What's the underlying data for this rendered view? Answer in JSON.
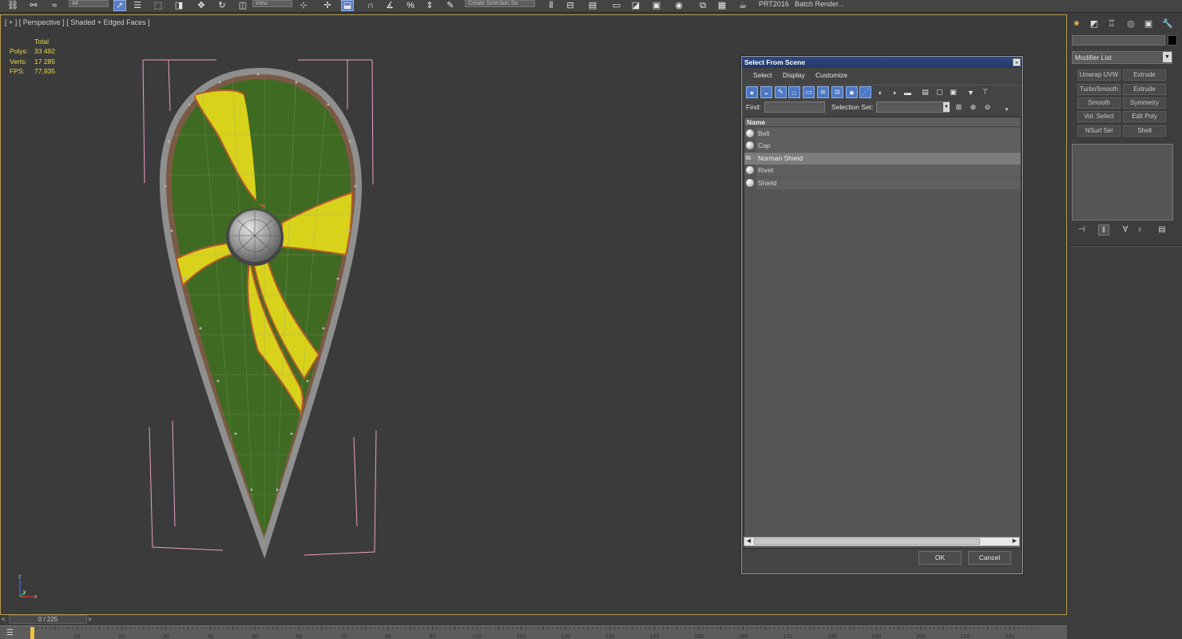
{
  "toolbar": {
    "filter_dropdown": "All",
    "coord_dropdown": "View",
    "selection_set_dropdown": "Create Selection Se",
    "prt_label": "PRT2016",
    "batch_render_label": "Batch Render..."
  },
  "viewport": {
    "label": "[ + ] [ Perspective ] [ Shaded + Edged Faces ]",
    "stats": {
      "total_label": "Total",
      "polys_label": "Polys:",
      "polys_value": "33 492",
      "verts_label": "Verts:",
      "verts_value": "17 285",
      "fps_label": "FPS:",
      "fps_value": "77,935"
    },
    "axis": {
      "z": "z",
      "y": "y",
      "x": "x"
    }
  },
  "dialog": {
    "title": "Select From Scene",
    "close": "×",
    "menu": [
      "Select",
      "Display",
      "Customize"
    ],
    "find_label": "Find:",
    "find_value": "",
    "selection_set_label": "Selection Set:",
    "column_header": "Name",
    "items": [
      {
        "name": "Belt",
        "icon": "sphere-icon",
        "selected": false
      },
      {
        "name": "Cap",
        "icon": "sphere-icon",
        "selected": false
      },
      {
        "name": "Norman Shield",
        "icon": "group-icon",
        "selected": true
      },
      {
        "name": "Rivet",
        "icon": "sphere-icon",
        "selected": false
      },
      {
        "name": "Shield",
        "icon": "sphere-icon",
        "selected": false
      }
    ],
    "ok_label": "OK",
    "cancel_label": "Cancel"
  },
  "command_panel": {
    "modifier_list": "Modifier List",
    "modifier_buttons": [
      "Unwrap UVW",
      "Extrude",
      "TurboSmooth",
      "Extrude",
      "Smooth",
      "Symmetry",
      "Vol. Select",
      "Edit Poly",
      "NSurf Sel",
      "Shell"
    ],
    "accent_color": "#f4b244"
  },
  "timeline": {
    "frame_display": "0 / 225",
    "prev": "<",
    "next": ">",
    "ruler_ticks": [
      "10",
      "20",
      "30",
      "40",
      "50",
      "60",
      "70",
      "80",
      "90",
      "100",
      "110",
      "120",
      "130",
      "140",
      "150",
      "160",
      "170",
      "180",
      "190",
      "200",
      "210",
      "220"
    ]
  },
  "colors": {
    "viewport_border": "#b59b4e",
    "stats_text": "#e9d84a",
    "selection_blue": "#4c78c6",
    "bounding_box": "#e8a0c8"
  }
}
